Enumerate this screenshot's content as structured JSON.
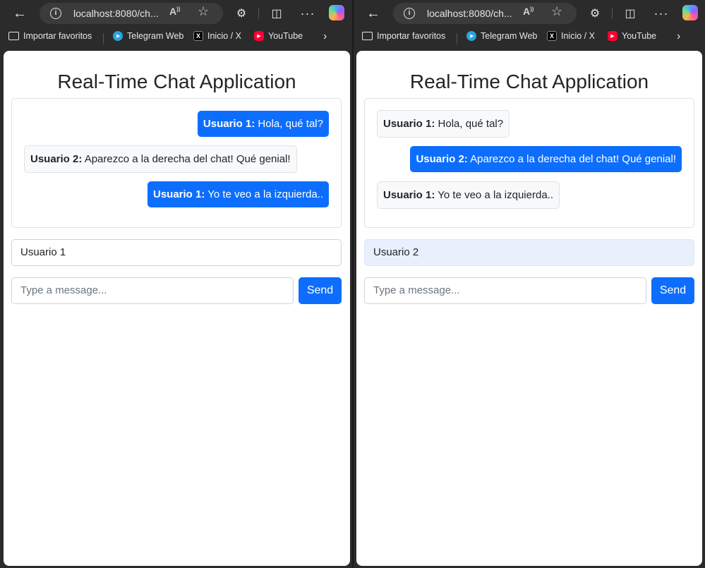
{
  "browser": {
    "url": "localhost:8080/ch...",
    "bookmarks": [
      "Importar favoritos",
      "Telegram Web",
      "Inicio / X",
      "YouTube"
    ]
  },
  "app": {
    "title": "Real-Time Chat Application",
    "message_placeholder": "Type a message...",
    "send_label": "Send"
  },
  "windows": [
    {
      "username": "Usuario 1",
      "messages": [
        {
          "sender": "Usuario 1:",
          "text": "Hola, qué tal?",
          "mine": true
        },
        {
          "sender": "Usuario 2:",
          "text": "Aparezco a la derecha del chat! Qué genial!",
          "mine": false
        },
        {
          "sender": "Usuario 1:",
          "text": "Yo te veo a la izquierda..",
          "mine": true
        }
      ]
    },
    {
      "username": "Usuario 2",
      "messages": [
        {
          "sender": "Usuario 1:",
          "text": "Hola, qué tal?",
          "mine": false
        },
        {
          "sender": "Usuario 2:",
          "text": "Aparezco a la derecha del chat! Qué genial!",
          "mine": true
        },
        {
          "sender": "Usuario 1:",
          "text": "Yo te veo a la izquierda..",
          "mine": false
        }
      ]
    }
  ]
}
